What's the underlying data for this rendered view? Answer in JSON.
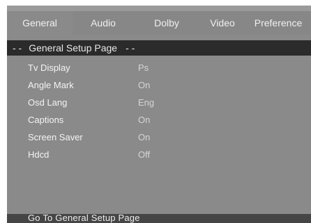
{
  "tabs": [
    {
      "label": "General",
      "active": true
    },
    {
      "label": "Audio",
      "active": false
    },
    {
      "label": "Dolby",
      "active": false
    },
    {
      "label": "Video",
      "active": false
    },
    {
      "label": "Preference",
      "active": false
    }
  ],
  "page": {
    "title_left_dash": "- -",
    "title": "General Setup Page",
    "title_right_dash": "- -"
  },
  "settings": [
    {
      "label": "Tv Display",
      "value": "Ps"
    },
    {
      "label": "Angle Mark",
      "value": "On"
    },
    {
      "label": "Osd Lang",
      "value": "Eng"
    },
    {
      "label": "Captions",
      "value": "On"
    },
    {
      "label": "Screen Saver",
      "value": "On"
    },
    {
      "label": "Hdcd",
      "value": "Off"
    }
  ],
  "footer": {
    "hint": "Go To General Setup Page"
  },
  "colors": {
    "background": "#8a8a8a",
    "header_bar": "#2b2b2b",
    "footer_bar": "#454545",
    "text": "#f0f0f0"
  }
}
